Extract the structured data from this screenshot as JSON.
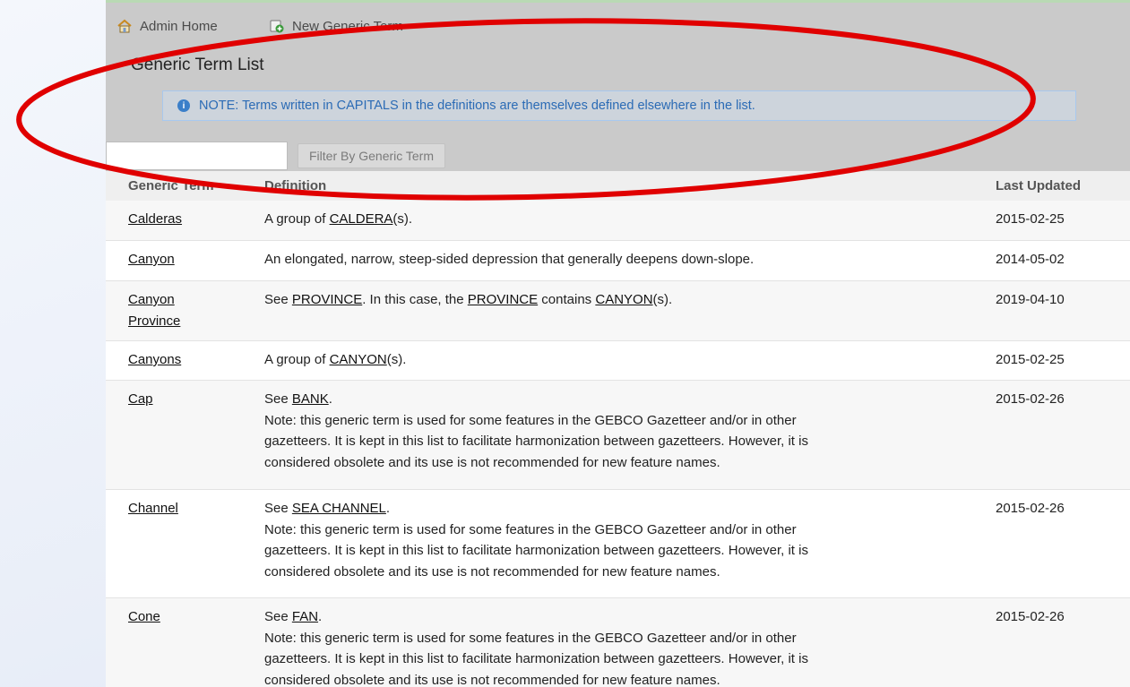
{
  "nav": {
    "home_label": "Admin Home",
    "new_label": "New Generic Term"
  },
  "page": {
    "title": "Generic Term List",
    "note": "NOTE: Terms written in CAPITALS in the definitions are themselves defined elsewhere in the list."
  },
  "filter": {
    "value": "",
    "button_label": "Filter By Generic Term"
  },
  "table": {
    "headers": {
      "term": "Generic Term",
      "definition": "Definition",
      "updated": "Last Updated"
    },
    "obsolete_note_line1": "Note: this generic term is used for some features in the GEBCO Gazetteer and/or in other",
    "obsolete_note_line2": "gazetteers. It is kept in this list to facilitate harmonization between gazetteers. However, it is",
    "obsolete_note_line3": "considered obsolete and its use is not recommended for new feature names.",
    "rows": [
      {
        "term": "Calderas",
        "def": {
          "a": "A group of ",
          "l1": "CALDERA",
          "b": "(s)."
        },
        "updated": "2015-02-25"
      },
      {
        "term": "Canyon",
        "def": {
          "a": "An elongated, narrow, steep-sided depression that generally deepens down-slope."
        },
        "updated": "2014-05-02"
      },
      {
        "term_line1": "Canyon",
        "term_line2": "Province",
        "def": {
          "a": "See ",
          "l1": "PROVINCE",
          "b": ". In this case, the ",
          "l2": "PROVINCE",
          "c": " contains ",
          "l3": "CANYON",
          "d": "(s)."
        },
        "updated": "2019-04-10"
      },
      {
        "term": "Canyons",
        "def": {
          "a": "A group of ",
          "l1": "CANYON",
          "b": "(s)."
        },
        "updated": "2015-02-25"
      },
      {
        "term": "Cap",
        "def": {
          "a": "See ",
          "l1": "BANK",
          "b": "."
        },
        "updated": "2015-02-26"
      },
      {
        "term": "Channel",
        "def": {
          "a": "See ",
          "l1": "SEA CHANNEL",
          "b": "."
        },
        "updated": "2015-02-26"
      },
      {
        "term": "Cone",
        "def": {
          "a": "See ",
          "l1": "FAN",
          "b": "."
        },
        "updated": "2015-02-26"
      }
    ]
  },
  "colors": {
    "header_bg": "#cacaca",
    "note_text": "#2b6bb5",
    "annotation_ellipse": "#e00000"
  }
}
